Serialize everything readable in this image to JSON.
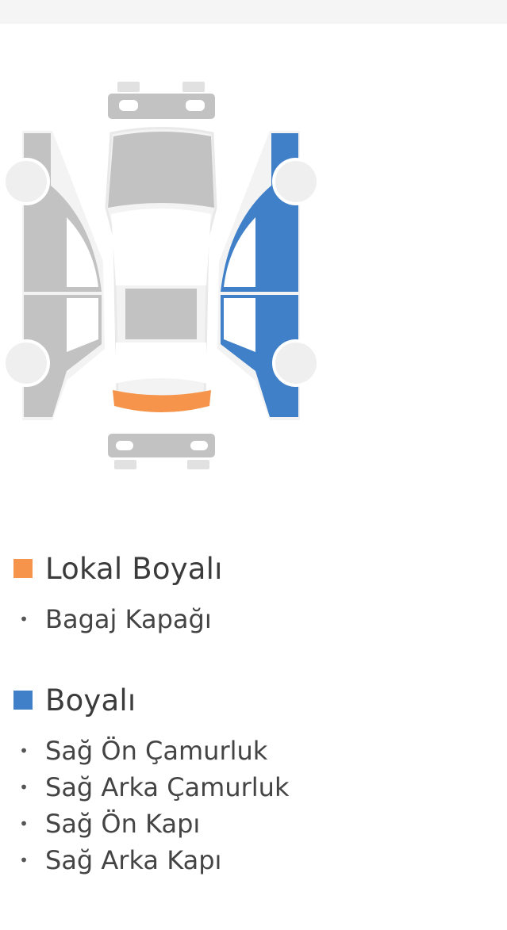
{
  "colors": {
    "local_painted": "#f5944a",
    "painted": "#3f80c8",
    "original": "#c2c2c2",
    "outline": "#efefef"
  },
  "legend": [
    {
      "title": "Lokal Boyalı",
      "color": "#f5944a",
      "items": [
        "Bagaj Kapağı"
      ]
    },
    {
      "title": "Boyalı",
      "color": "#3f80c8",
      "items": [
        "Sağ Ön Çamurluk",
        "Sağ Arka Çamurluk",
        "Sağ Ön Kapı",
        "Sağ Arka Kapı"
      ]
    }
  ]
}
